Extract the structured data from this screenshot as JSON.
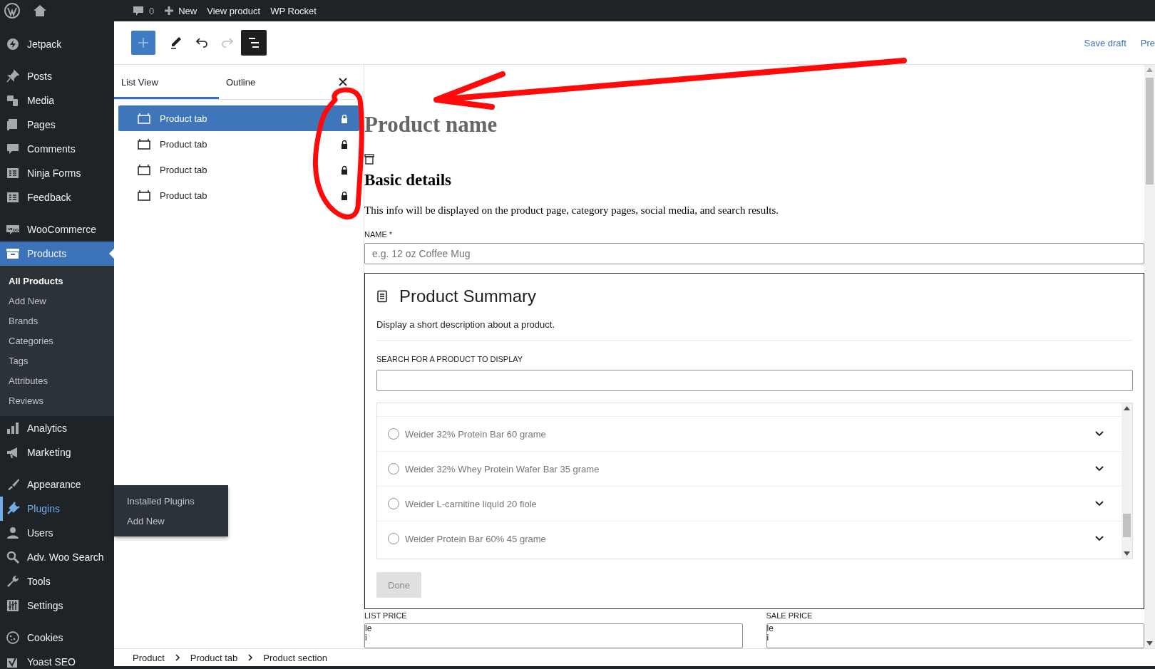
{
  "admin_bar": {
    "comments_count": "0",
    "items": [
      {
        "label": "New",
        "kind": "new"
      },
      {
        "label": "View product",
        "kind": "link"
      },
      {
        "label": "WP Rocket",
        "kind": "link"
      }
    ]
  },
  "sidebar": {
    "groups": [
      [
        {
          "label": "Jetpack",
          "selected": false,
          "hovered": false
        }
      ],
      [
        {
          "label": "Posts",
          "selected": false,
          "hovered": false
        },
        {
          "label": "Media",
          "selected": false,
          "hovered": false
        },
        {
          "label": "Pages",
          "selected": false,
          "hovered": false
        },
        {
          "label": "Comments",
          "selected": false,
          "hovered": false
        },
        {
          "label": "Ninja Forms",
          "selected": false,
          "hovered": false
        },
        {
          "label": "Feedback",
          "selected": false,
          "hovered": false
        }
      ],
      [
        {
          "label": "WooCommerce",
          "selected": false,
          "hovered": false
        },
        {
          "label": "Products",
          "selected": true,
          "hovered": false,
          "submenu": [
            {
              "label": "All Products",
              "selected": true
            },
            {
              "label": "Add New",
              "selected": false
            },
            {
              "label": "Brands",
              "selected": false
            },
            {
              "label": "Categories",
              "selected": false
            },
            {
              "label": "Tags",
              "selected": false
            },
            {
              "label": "Attributes",
              "selected": false
            },
            {
              "label": "Reviews",
              "selected": false
            }
          ]
        },
        {
          "label": "Analytics",
          "selected": false,
          "hovered": false
        },
        {
          "label": "Marketing",
          "selected": false,
          "hovered": false
        }
      ],
      [
        {
          "label": "Appearance",
          "selected": false,
          "hovered": false
        },
        {
          "label": "Plugins",
          "selected": false,
          "hovered": true,
          "flyout": [
            "Installed Plugins",
            "Add New"
          ]
        },
        {
          "label": "Users",
          "selected": false,
          "hovered": false
        },
        {
          "label": "Adv. Woo Search",
          "selected": false,
          "hovered": false
        },
        {
          "label": "Tools",
          "selected": false,
          "hovered": false
        },
        {
          "label": "Settings",
          "selected": false,
          "hovered": false
        }
      ],
      [
        {
          "label": "Cookies",
          "selected": false,
          "hovered": false
        },
        {
          "label": "Yoast SEO",
          "selected": false,
          "hovered": false
        }
      ]
    ]
  },
  "editor_header": {
    "actions": [
      "Save draft",
      "Pre"
    ]
  },
  "list_view": {
    "tabs": [
      {
        "label": "List View",
        "selected": true
      },
      {
        "label": "Outline",
        "selected": false
      }
    ],
    "rows": [
      {
        "label": "Product tab",
        "selected": true,
        "locked": true
      },
      {
        "label": "Product tab",
        "selected": false,
        "locked": true
      },
      {
        "label": "Product tab",
        "selected": false,
        "locked": true
      },
      {
        "label": "Product tab",
        "selected": false,
        "locked": true
      }
    ]
  },
  "content": {
    "title": "Product name",
    "section_title": "Basic details",
    "section_description": "This info will be displayed on the product page, category pages, social media, and search results.",
    "name_field": {
      "label": "NAME *",
      "placeholder": "e.g. 12 oz Coffee Mug"
    },
    "summary": {
      "title": "Product Summary",
      "description": "Display a short description about a product.",
      "search_label": "SEARCH FOR A PRODUCT TO DISPLAY",
      "results": [
        {
          "label": "Weider 32% Protein Bar 60 grame",
          "selected": false
        },
        {
          "label": "Weider 32% Whey Protein Wafer Bar 35 grame",
          "selected": false
        },
        {
          "label": "Weider L-carnitine liquid 20 fiole",
          "selected": false
        },
        {
          "label": "Weider Protein Bar 60% 45 grame",
          "selected": false
        }
      ],
      "done": {
        "label": "Done",
        "disabled": true
      }
    },
    "prices": [
      {
        "label": "LIST PRICE",
        "lines": [
          "le",
          "i"
        ]
      },
      {
        "label": "SALE PRICE",
        "lines": [
          "le",
          "i"
        ]
      }
    ]
  },
  "breadcrumb": [
    "Product",
    "Product tab",
    "Product section"
  ]
}
